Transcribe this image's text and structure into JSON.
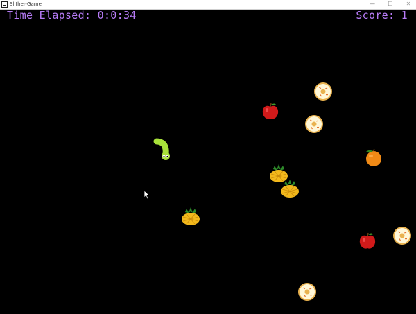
{
  "window": {
    "title": "Slither-Game",
    "minimize_glyph": "—",
    "maximize_glyph": "☐",
    "close_glyph": "✕"
  },
  "hud": {
    "time_label": "Time Elapsed: 0:0:34",
    "score_label": "Score: 1"
  },
  "colors": {
    "hud_text": "#b77cf7",
    "background": "#000000",
    "snake": "#a8e23a"
  },
  "food_items": [
    {
      "type": "donut"
    },
    {
      "type": "apple"
    },
    {
      "type": "donut"
    },
    {
      "type": "orange"
    },
    {
      "type": "pineapple"
    },
    {
      "type": "pineapple"
    },
    {
      "type": "pineapple"
    },
    {
      "type": "donut"
    },
    {
      "type": "apple"
    },
    {
      "type": "donut"
    }
  ]
}
